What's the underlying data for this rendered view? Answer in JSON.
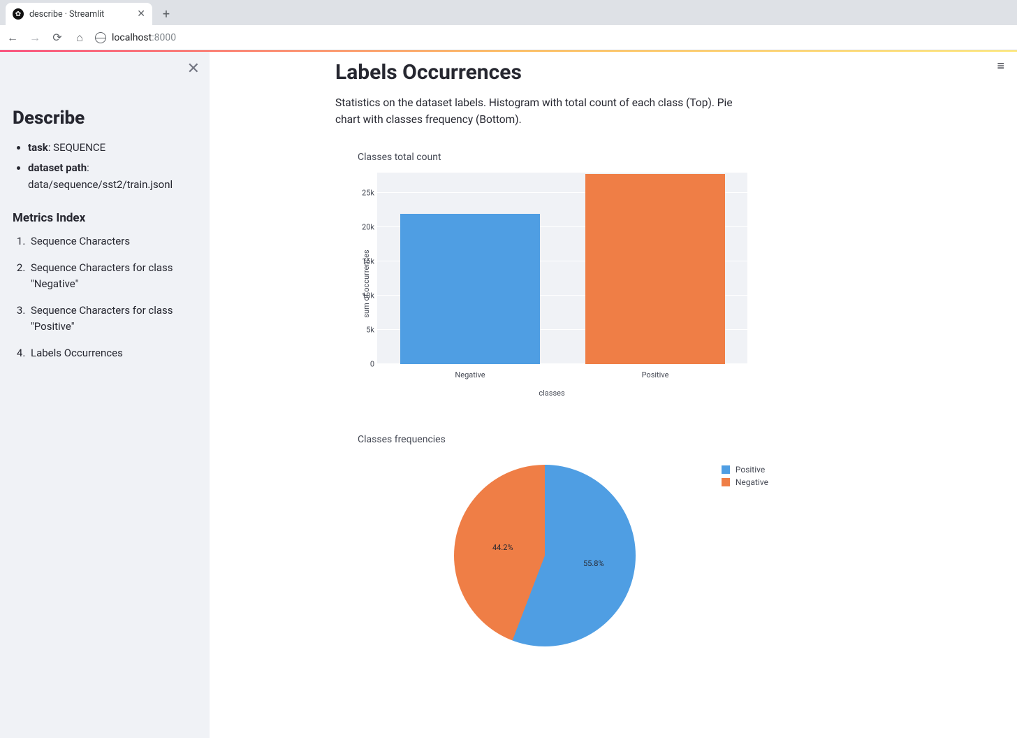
{
  "browser": {
    "tab_title": "describe · Streamlit",
    "url_host": "localhost",
    "url_port": ":8000"
  },
  "sidebar": {
    "title": "Describe",
    "meta": [
      {
        "key": "task",
        "value": ": SEQUENCE"
      },
      {
        "key": "dataset path",
        "value": ": data/sequence/sst2/train.jsonl"
      }
    ],
    "index_title": "Metrics Index",
    "index": [
      "Sequence Characters",
      "Sequence Characters for class \"Negative\"",
      "Sequence Characters for class \"Positive\"",
      "Labels Occurrences"
    ]
  },
  "main": {
    "heading": "Labels Occurrences",
    "description": "Statistics on the dataset labels. Histogram with total count of each class (Top). Pie chart with classes frequency (Bottom)."
  },
  "chart_data": [
    {
      "type": "bar",
      "title": "Classes total count",
      "xlabel": "classes",
      "ylabel": "sum of occurrences",
      "categories": [
        "Negative",
        "Positive"
      ],
      "values": [
        22000,
        27800
      ],
      "yticks": [
        "0",
        "5k",
        "10k",
        "15k",
        "20k",
        "25k"
      ],
      "ylim": [
        0,
        28000
      ],
      "colors": {
        "Negative": "#4f9ee3",
        "Positive": "#ef7e46"
      }
    },
    {
      "type": "pie",
      "title": "Classes frequencies",
      "series": [
        {
          "name": "Positive",
          "value": 55.8,
          "label": "55.8%",
          "color": "#4f9ee3"
        },
        {
          "name": "Negative",
          "value": 44.2,
          "label": "44.2%",
          "color": "#ef7e46"
        }
      ],
      "legend": [
        "Positive",
        "Negative"
      ]
    }
  ]
}
